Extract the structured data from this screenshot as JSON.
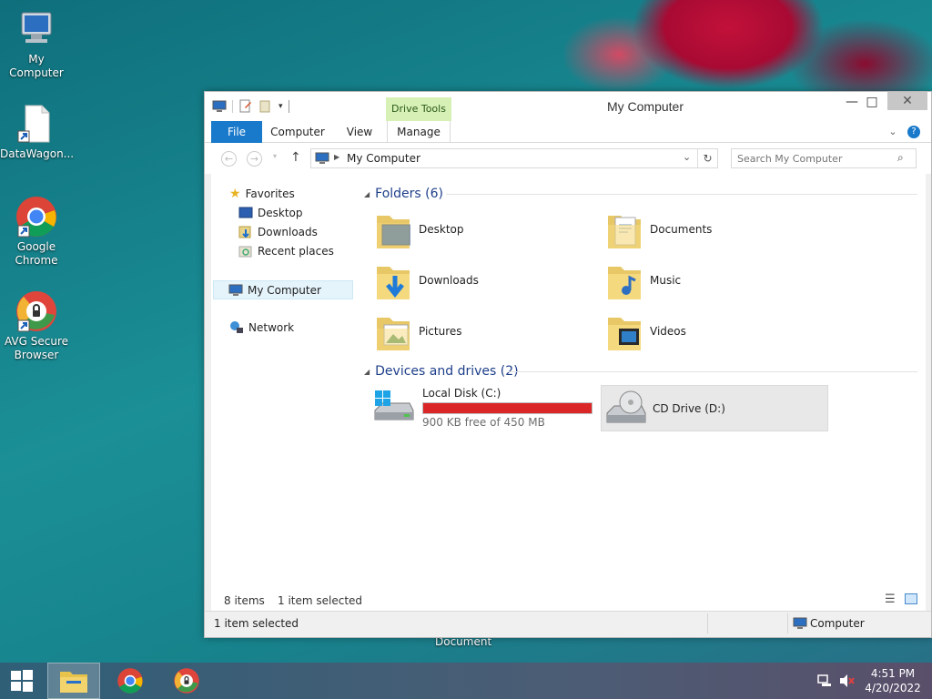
{
  "desktop": {
    "icons": [
      {
        "label": "My Computer",
        "icon": "computer-icon"
      },
      {
        "label": "DataWagon...",
        "icon": "document-icon"
      },
      {
        "label": "Google Chrome",
        "icon": "chrome-icon"
      },
      {
        "label": "AVG Secure Browser",
        "icon": "avg-browser-icon"
      }
    ],
    "stray_label": "Document"
  },
  "window": {
    "title": "My Computer",
    "minimize_label": "—",
    "maximize_label": "□",
    "close_label": "✕",
    "tabs": {
      "file": "File",
      "computer": "Computer",
      "view": "View",
      "manage": "Manage",
      "drive_tools": "Drive Tools"
    },
    "help_label": "?",
    "address": {
      "current": "My Computer"
    },
    "search": {
      "placeholder": "Search My Computer"
    }
  },
  "nav": {
    "favorites": "Favorites",
    "favorite_items": [
      "Desktop",
      "Downloads",
      "Recent places"
    ],
    "my_computer": "My Computer",
    "network": "Network"
  },
  "content": {
    "folders_header": "Folders (6)",
    "folders": [
      "Desktop",
      "Documents",
      "Downloads",
      "Music",
      "Pictures",
      "Videos"
    ],
    "drives_header": "Devices and drives (2)",
    "drives": [
      {
        "name": "Local Disk (C:)",
        "free": "900 KB free of 450 MB",
        "used_fraction": 0.998,
        "bar_color": "#da2626"
      },
      {
        "name": "CD Drive (D:)"
      }
    ]
  },
  "status": {
    "items_count": "8 items",
    "selected": "1 item selected",
    "bottom_selected": "1 item selected",
    "location": "Computer"
  },
  "taskbar": {
    "time": "4:51 PM",
    "date": "4/20/2022"
  },
  "colors": {
    "accent": "#1979ca",
    "drive_tools": "#d6f0b5"
  }
}
